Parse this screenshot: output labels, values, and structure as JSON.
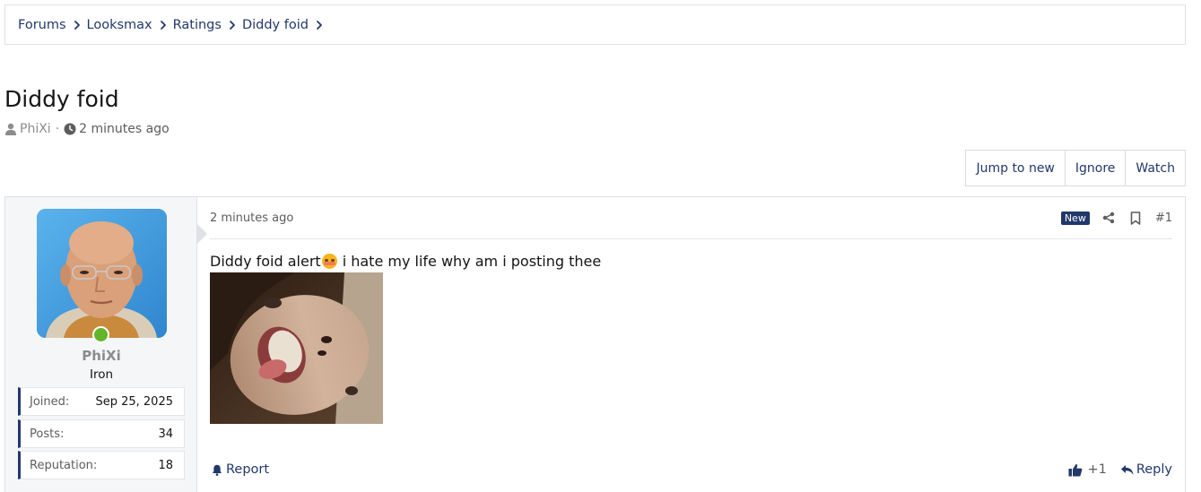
{
  "breadcrumb": [
    "Forums",
    "Looksmax",
    "Ratings",
    "Diddy foid"
  ],
  "thread": {
    "title": "Diddy foid",
    "author": "PhiXi",
    "time": "2 minutes ago"
  },
  "actions": {
    "jump_to_new": "Jump to new",
    "ignore": "Ignore",
    "watch": "Watch"
  },
  "post": {
    "user": {
      "name": "PhiXi",
      "title": "Iron",
      "online": true,
      "stats": [
        {
          "label": "Joined:",
          "value": "Sep 25, 2025"
        },
        {
          "label": "Posts:",
          "value": "34"
        },
        {
          "label": "Reputation:",
          "value": "18"
        }
      ]
    },
    "time": "2 minutes ago",
    "badge": "New",
    "number": "#1",
    "body_before_emoji": "Diddy foid alert",
    "body_after_emoji": "i hate my life why am i posting thee",
    "emoji": "flushed-face",
    "report": "Report",
    "like_count": "+1",
    "reply": "Reply"
  },
  "colors": {
    "link": "#22386b",
    "online": "#63b52b",
    "badge_bg": "#22386b"
  }
}
